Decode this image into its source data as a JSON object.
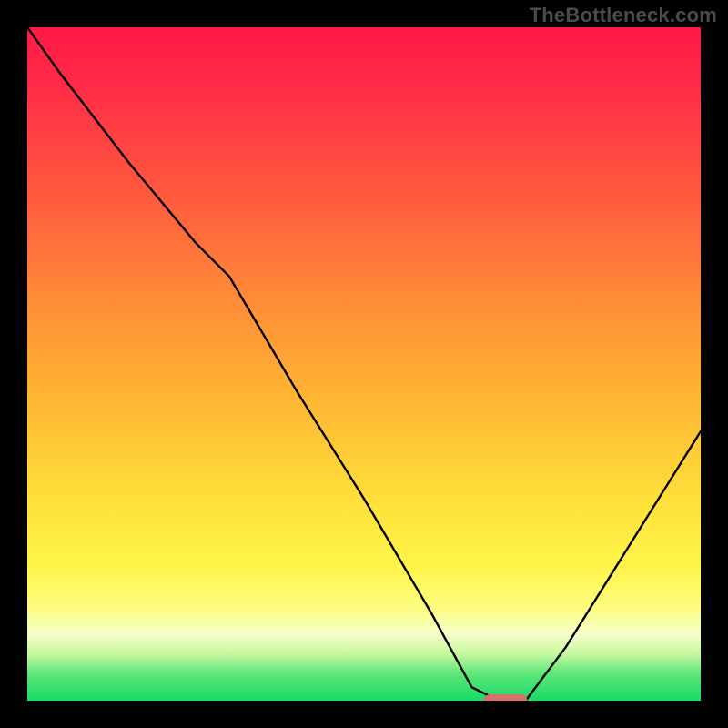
{
  "watermark": "TheBottleneck.com",
  "chart_data": {
    "type": "line",
    "title": "",
    "xlabel": "",
    "ylabel": "",
    "xlim": [
      0,
      100
    ],
    "ylim": [
      0,
      100
    ],
    "background_gradient": {
      "top": "#ff1846",
      "bottom": "#18db66",
      "meaning": "red = high bottleneck, green = low bottleneck"
    },
    "series": [
      {
        "name": "bottleneck-curve",
        "x": [
          0,
          5,
          15,
          25,
          30,
          40,
          50,
          60,
          66,
          70,
          74,
          80,
          90,
          100
        ],
        "y": [
          100,
          93,
          80,
          68,
          63,
          46,
          30,
          13,
          2,
          0,
          0,
          8,
          24,
          40
        ]
      }
    ],
    "marker": {
      "name": "optimal-point",
      "x": 71,
      "y": 0,
      "color": "#d96e6c",
      "shape": "rounded-bar"
    }
  }
}
